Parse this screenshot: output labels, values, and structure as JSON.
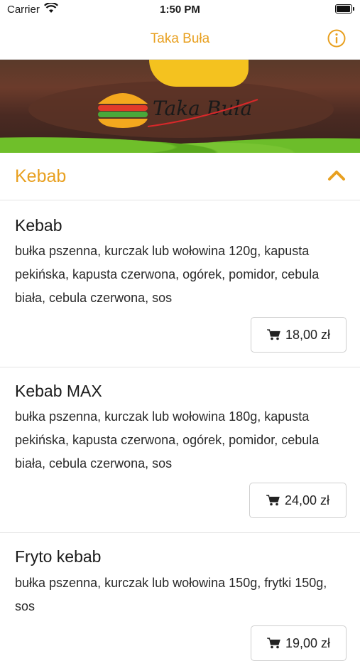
{
  "status": {
    "carrier": "Carrier",
    "time": "1:50 PM"
  },
  "nav": {
    "title": "Taka Buła",
    "info_icon": "info-icon"
  },
  "banner": {
    "logo_text": "Taka Buła"
  },
  "section": {
    "title": "Kebab",
    "toggle_icon": "chevron-up-icon"
  },
  "items": [
    {
      "name": "Kebab",
      "description": "bułka pszenna, kurczak lub wołowina 120g, kapusta pekińska, kapusta czerwona, ogórek, pomidor, cebula biała, cebula czerwona, sos",
      "price": "18,00 zł"
    },
    {
      "name": "Kebab MAX",
      "description": "bułka pszenna, kurczak lub wołowina 180g, kapusta pekińska, kapusta czerwona, ogórek, pomidor, cebula biała, cebula czerwona, sos",
      "price": "24,00 zł"
    },
    {
      "name": "Fryto kebab",
      "description": "bułka pszenna, kurczak lub wołowina 150g, frytki 150g, sos",
      "price": "19,00 zł"
    }
  ],
  "colors": {
    "accent": "#e8a020",
    "divider": "#e4e4e4"
  }
}
